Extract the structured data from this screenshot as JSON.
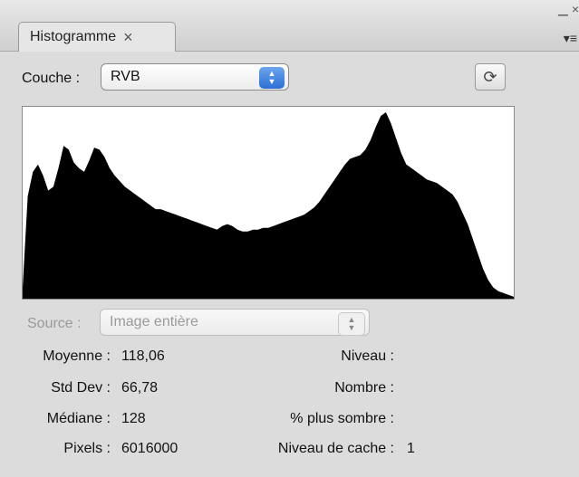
{
  "panel": {
    "tab_title": "Histogramme",
    "tab_close": "×",
    "minimize": "–",
    "close": "×",
    "menu": "▾≡"
  },
  "channel": {
    "label": "Couche :",
    "selected": "RVB"
  },
  "refresh_icon": "⟳",
  "histogram": {
    "values": [
      0.06,
      0.55,
      0.68,
      0.72,
      0.66,
      0.58,
      0.6,
      0.7,
      0.82,
      0.8,
      0.73,
      0.7,
      0.68,
      0.74,
      0.81,
      0.8,
      0.76,
      0.7,
      0.66,
      0.63,
      0.6,
      0.58,
      0.56,
      0.54,
      0.52,
      0.5,
      0.48,
      0.48,
      0.47,
      0.46,
      0.45,
      0.44,
      0.43,
      0.42,
      0.41,
      0.4,
      0.39,
      0.38,
      0.37,
      0.39,
      0.4,
      0.39,
      0.37,
      0.36,
      0.36,
      0.37,
      0.37,
      0.38,
      0.38,
      0.39,
      0.4,
      0.41,
      0.42,
      0.43,
      0.44,
      0.45,
      0.47,
      0.49,
      0.52,
      0.56,
      0.6,
      0.64,
      0.68,
      0.72,
      0.75,
      0.76,
      0.77,
      0.8,
      0.85,
      0.92,
      0.98,
      1.0,
      0.94,
      0.86,
      0.78,
      0.72,
      0.7,
      0.68,
      0.66,
      0.64,
      0.63,
      0.62,
      0.6,
      0.58,
      0.56,
      0.52,
      0.46,
      0.4,
      0.32,
      0.24,
      0.16,
      0.1,
      0.06,
      0.04,
      0.03,
      0.02,
      0.01
    ]
  },
  "source": {
    "label": "Source :",
    "selected": "Image entière"
  },
  "stats": {
    "moyenne_label": "Moyenne :",
    "moyenne_value": "118,06",
    "stddev_label": "Std Dev :",
    "stddev_value": "66,78",
    "mediane_label": "Médiane :",
    "mediane_value": "128",
    "pixels_label": "Pixels :",
    "pixels_value": "6016000",
    "niveau_label": "Niveau :",
    "niveau_value": "",
    "nombre_label": "Nombre :",
    "nombre_value": "",
    "sombre_label": "% plus sombre :",
    "sombre_value": "",
    "cache_label": "Niveau de cache :",
    "cache_value": "1"
  }
}
